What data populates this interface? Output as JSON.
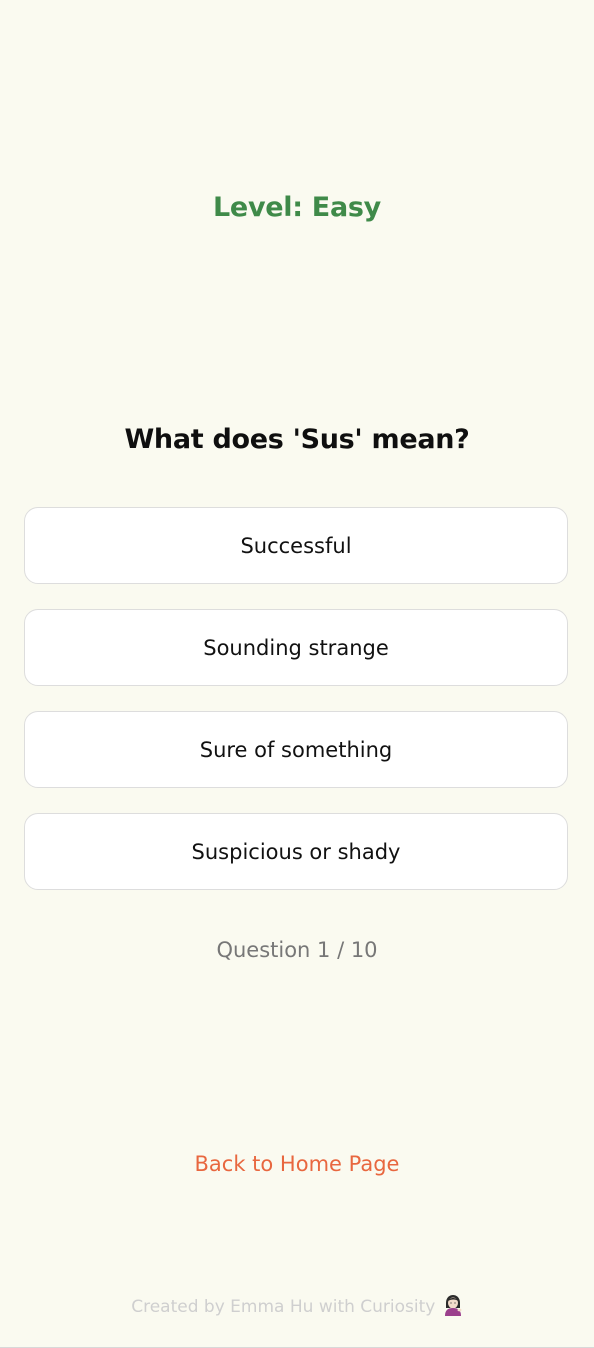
{
  "level": {
    "text": "Level: Easy",
    "color": "#3f8a49"
  },
  "question": {
    "text": "What does 'Sus' mean?"
  },
  "answers": [
    {
      "label": "Successful"
    },
    {
      "label": "Sounding strange"
    },
    {
      "label": "Sure of something"
    },
    {
      "label": "Suspicious or shady"
    }
  ],
  "progress": {
    "text": "Question 1 / 10",
    "current": 1,
    "total": 10
  },
  "navigation": {
    "back_label": "Back to Home Page",
    "color": "#e8673f"
  },
  "footer": {
    "text": "Created by Emma Hu with Curiosity",
    "icon": "woman-tipping-hand-emoji"
  }
}
